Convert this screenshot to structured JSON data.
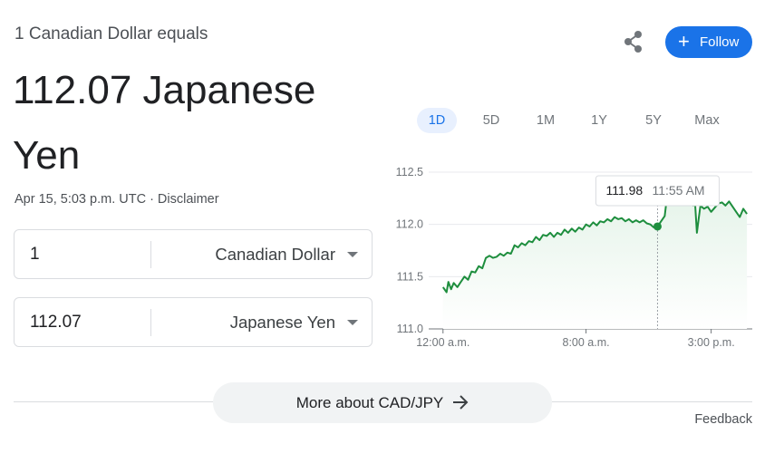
{
  "header": {
    "subtitle": "1 Canadian Dollar equals",
    "result": "112.07 Japanese Yen",
    "timestamp": "Apr 15, 5:03 p.m. UTC",
    "separator": "·",
    "disclaimer": "Disclaimer"
  },
  "actions": {
    "share_icon": "share-icon",
    "follow_label": "Follow",
    "follow_icon": "+"
  },
  "converter": {
    "from": {
      "value": "1",
      "currency": "Canadian Dollar"
    },
    "to": {
      "value": "112.07",
      "currency": "Japanese Yen"
    }
  },
  "range_tabs": [
    {
      "label": "1D",
      "active": true
    },
    {
      "label": "5D",
      "active": false
    },
    {
      "label": "1M",
      "active": false
    },
    {
      "label": "1Y",
      "active": false
    },
    {
      "label": "5Y",
      "active": false
    },
    {
      "label": "Max",
      "active": false
    }
  ],
  "tooltip": {
    "value": "111.98",
    "time": "11:55 AM"
  },
  "chart_data": {
    "type": "area",
    "x_tick_labels": [
      "12:00 a.m.",
      "8:00 a.m.",
      "3:00 p.m."
    ],
    "x_tick_hours": [
      0,
      8,
      15
    ],
    "xlim": [
      -0.8,
      17.3
    ],
    "ylim": [
      111.0,
      112.5
    ],
    "y_ticks": [
      111.0,
      111.5,
      112.0,
      112.5
    ],
    "y_tick_labels": [
      "111.0",
      "111.5",
      "112.0",
      "112.5"
    ],
    "hover_hour": 12.0,
    "hover_value": 111.98,
    "colors": {
      "line": "#1e8e3e",
      "fill": "#e6f4ea",
      "grid": "#e8eaed",
      "axis": "#70757a"
    },
    "series": [
      {
        "points": [
          [
            0.0,
            111.4
          ],
          [
            0.2,
            111.35
          ],
          [
            0.3,
            111.45
          ],
          [
            0.45,
            111.38
          ],
          [
            0.6,
            111.44
          ],
          [
            0.8,
            111.4
          ],
          [
            1.0,
            111.45
          ],
          [
            1.2,
            111.5
          ],
          [
            1.4,
            111.47
          ],
          [
            1.6,
            111.55
          ],
          [
            1.8,
            111.54
          ],
          [
            2.0,
            111.6
          ],
          [
            2.2,
            111.58
          ],
          [
            2.4,
            111.68
          ],
          [
            2.6,
            111.7
          ],
          [
            2.8,
            111.68
          ],
          [
            3.0,
            111.69
          ],
          [
            3.2,
            111.72
          ],
          [
            3.4,
            111.7
          ],
          [
            3.6,
            111.73
          ],
          [
            3.8,
            111.72
          ],
          [
            4.0,
            111.8
          ],
          [
            4.2,
            111.78
          ],
          [
            4.4,
            111.82
          ],
          [
            4.6,
            111.8
          ],
          [
            4.8,
            111.84
          ],
          [
            5.0,
            111.83
          ],
          [
            5.2,
            111.88
          ],
          [
            5.4,
            111.85
          ],
          [
            5.6,
            111.9
          ],
          [
            5.8,
            111.89
          ],
          [
            6.0,
            111.92
          ],
          [
            6.2,
            111.88
          ],
          [
            6.4,
            111.92
          ],
          [
            6.6,
            111.9
          ],
          [
            6.8,
            111.95
          ],
          [
            7.0,
            111.92
          ],
          [
            7.2,
            111.96
          ],
          [
            7.4,
            111.93
          ],
          [
            7.6,
            111.97
          ],
          [
            7.8,
            111.95
          ],
          [
            8.0,
            112.0
          ],
          [
            8.2,
            111.98
          ],
          [
            8.4,
            112.02
          ],
          [
            8.6,
            111.99
          ],
          [
            8.8,
            112.03
          ],
          [
            9.0,
            112.02
          ],
          [
            9.2,
            112.05
          ],
          [
            9.4,
            112.03
          ],
          [
            9.6,
            112.07
          ],
          [
            9.8,
            112.05
          ],
          [
            10.0,
            112.06
          ],
          [
            10.2,
            112.03
          ],
          [
            10.4,
            112.05
          ],
          [
            10.6,
            112.02
          ],
          [
            10.8,
            112.04
          ],
          [
            11.0,
            112.02
          ],
          [
            11.2,
            112.04
          ],
          [
            11.4,
            112.01
          ],
          [
            11.6,
            112.0
          ],
          [
            11.8,
            111.97
          ],
          [
            12.0,
            111.98
          ],
          [
            12.2,
            112.03
          ],
          [
            12.4,
            112.08
          ],
          [
            12.5,
            112.22
          ],
          [
            12.7,
            112.25
          ],
          [
            13.0,
            112.24
          ],
          [
            13.3,
            112.25
          ],
          [
            13.6,
            112.23
          ],
          [
            13.8,
            112.22
          ],
          [
            14.0,
            112.18
          ],
          [
            14.1,
            112.2
          ],
          [
            14.2,
            111.92
          ],
          [
            14.3,
            112.05
          ],
          [
            14.4,
            112.18
          ],
          [
            14.6,
            112.15
          ],
          [
            14.8,
            112.17
          ],
          [
            15.0,
            112.12
          ],
          [
            15.2,
            112.16
          ],
          [
            15.4,
            112.2
          ],
          [
            15.6,
            112.21
          ],
          [
            15.8,
            112.18
          ],
          [
            16.0,
            112.22
          ],
          [
            16.2,
            112.17
          ],
          [
            16.4,
            112.12
          ],
          [
            16.6,
            112.07
          ],
          [
            16.8,
            112.15
          ],
          [
            17.0,
            112.1
          ]
        ]
      }
    ]
  },
  "footer": {
    "more_about": "More about CAD/JPY",
    "feedback": "Feedback"
  }
}
